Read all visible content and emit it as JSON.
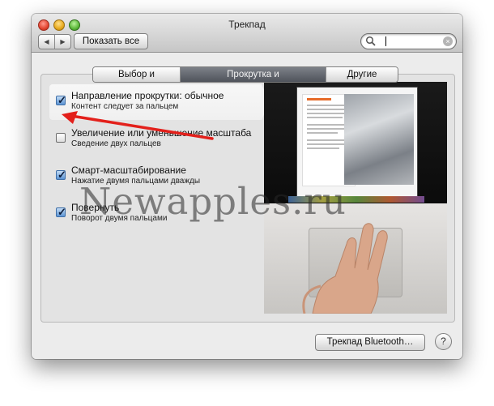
{
  "window": {
    "title": "Трекпад",
    "toolbar": {
      "back_icon": "chevron-left-icon",
      "forward_icon": "chevron-right-icon",
      "show_all_label": "Показать все",
      "search_placeholder": "",
      "search_value": ""
    }
  },
  "tabs": [
    {
      "label": "Выбор и нажатие",
      "selected": false
    },
    {
      "label": "Прокрутка и масштабирование",
      "selected": true
    },
    {
      "label": "Другие жесты",
      "selected": false
    }
  ],
  "options": [
    {
      "title": "Направление прокрутки: обычное",
      "subtitle": "Контент следует за пальцем",
      "checked": true,
      "selected": true
    },
    {
      "title": "Увеличение или уменьшение масштаба",
      "subtitle": "Сведение двух пальцев",
      "checked": false,
      "selected": false
    },
    {
      "title": "Смарт-масштабирование",
      "subtitle": "Нажатие двумя пальцами дважды",
      "checked": true,
      "selected": false
    },
    {
      "title": "Повернуть",
      "subtitle": "Поворот двумя пальцами",
      "checked": true,
      "selected": false
    }
  ],
  "preview": {
    "doc_heading": "Overview"
  },
  "footer": {
    "bluetooth_button_label": "Трекпад Bluetooth…",
    "help_label": "?"
  },
  "watermark": "Newapples.ru",
  "colors": {
    "arrow": "#e3201b",
    "selected_tab": "#5d6169",
    "checkbox_checked": "#5b93d3"
  }
}
